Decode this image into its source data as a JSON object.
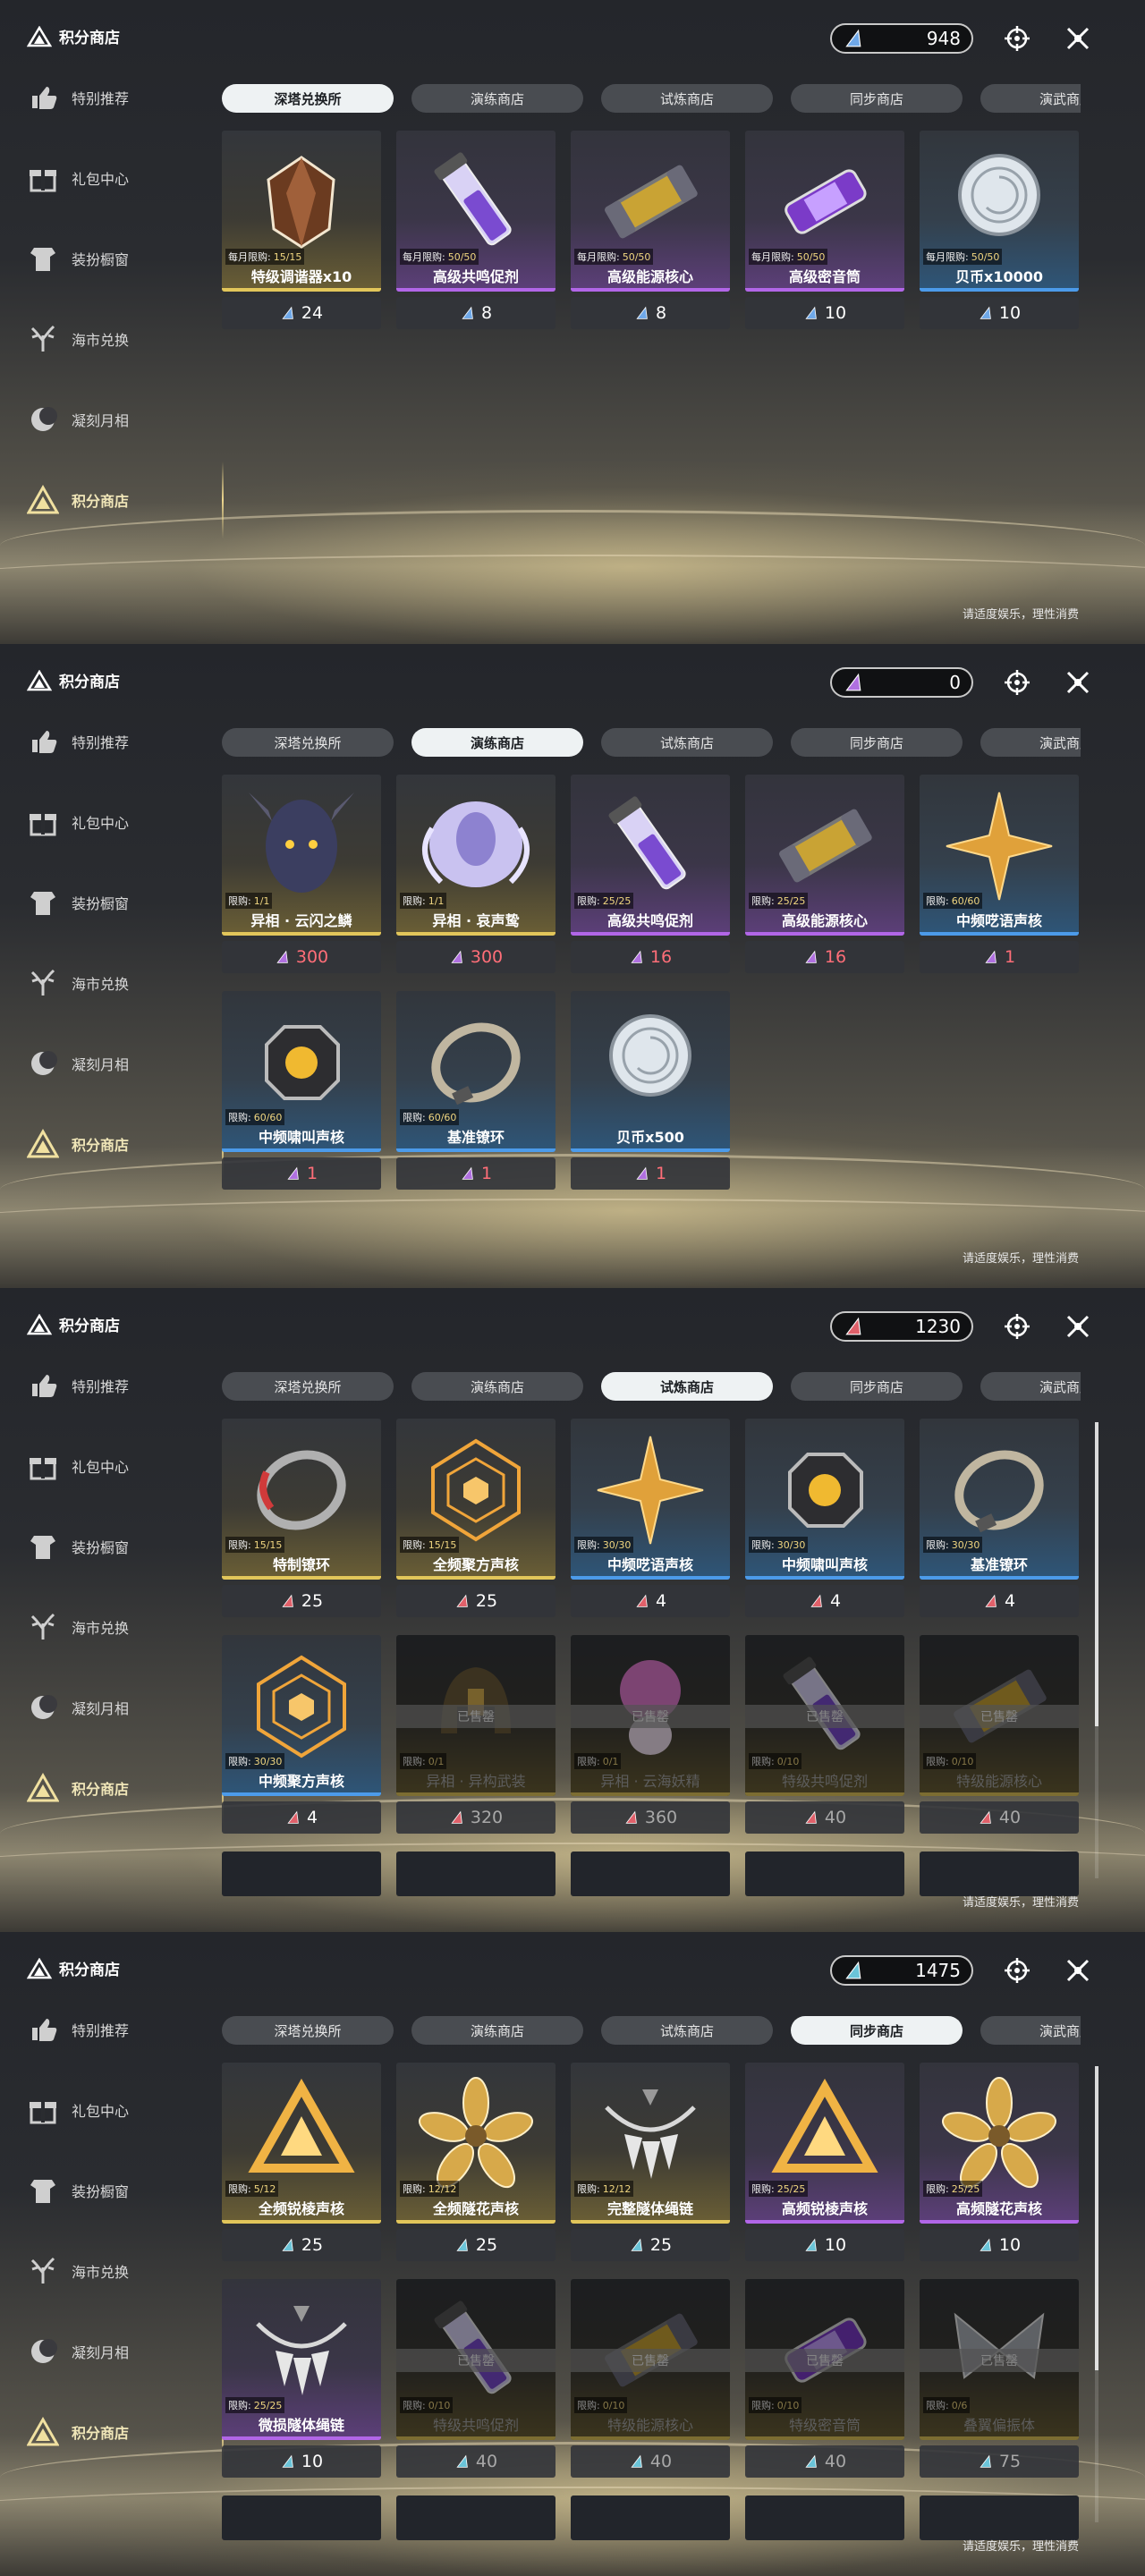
{
  "footer": "请适度娱乐，理性消费",
  "sidebar_title": "积分商店",
  "sidebar_items": [
    {
      "label": "特别推荐",
      "icon": "thumb-up-icon"
    },
    {
      "label": "礼包中心",
      "icon": "gift-icon"
    },
    {
      "label": "装扮橱窗",
      "icon": "wardrobe-icon"
    },
    {
      "label": "海市兑换",
      "icon": "coral-icon"
    },
    {
      "label": "凝刻月相",
      "icon": "moon-icon"
    },
    {
      "label": "积分商店",
      "icon": "triangle-icon"
    }
  ],
  "tabs": [
    "深塔兑换所",
    "演练商店",
    "试炼商店",
    "同步商店",
    "演武商店"
  ],
  "colors": {
    "gold": "#e2c65a",
    "purple": "#b266e8",
    "blue": "#4c9bea",
    "price_red": "#ff6e78"
  },
  "panels": [
    {
      "active_tab": 0,
      "currency": {
        "amount": "948",
        "color": "#6fa8e8"
      },
      "scroll": false,
      "items": [
        {
          "limit_label": "每月限购:",
          "limit": "15/15",
          "name": "特级调谐器x10",
          "price": "24",
          "quality": "gold",
          "art": "crystal",
          "sold": false,
          "red": false
        },
        {
          "limit_label": "每月限购:",
          "limit": "50/50",
          "name": "高级共鸣促剂",
          "price": "8",
          "quality": "purple",
          "art": "vial",
          "sold": false,
          "red": false
        },
        {
          "limit_label": "每月限购:",
          "limit": "50/50",
          "name": "高级能源核心",
          "price": "8",
          "quality": "purple",
          "art": "capsule",
          "sold": false,
          "red": false
        },
        {
          "limit_label": "每月限购:",
          "limit": "50/50",
          "name": "高级密音筒",
          "price": "10",
          "quality": "purple",
          "art": "tube",
          "sold": false,
          "red": false
        },
        {
          "limit_label": "每月限购:",
          "limit": "50/50",
          "name": "贝币x10000",
          "price": "10",
          "quality": "blue",
          "art": "coin",
          "sold": false,
          "red": false
        }
      ]
    },
    {
      "active_tab": 1,
      "currency": {
        "amount": "0",
        "color": "#b070e0"
      },
      "scroll": false,
      "items": [
        {
          "limit_label": "限购:",
          "limit": "1/1",
          "name": "异相 · 云闪之鳞",
          "price": "300",
          "quality": "gold",
          "art": "mask",
          "sold": false,
          "red": true
        },
        {
          "limit_label": "限购:",
          "limit": "1/1",
          "name": "异相 · 哀声鸷",
          "price": "300",
          "quality": "gold",
          "art": "bird",
          "sold": false,
          "red": true
        },
        {
          "limit_label": "限购:",
          "limit": "25/25",
          "name": "高级共鸣促剂",
          "price": "16",
          "quality": "purple",
          "art": "vial",
          "sold": false,
          "red": true
        },
        {
          "limit_label": "限购:",
          "limit": "25/25",
          "name": "高级能源核心",
          "price": "16",
          "quality": "purple",
          "art": "capsule",
          "sold": false,
          "red": true
        },
        {
          "limit_label": "限购:",
          "limit": "60/60",
          "name": "中频呓语声核",
          "price": "1",
          "quality": "blue",
          "art": "star",
          "sold": false,
          "red": true
        },
        {
          "limit_label": "限购:",
          "limit": "60/60",
          "name": "中频啸叫声核",
          "price": "1",
          "quality": "blue",
          "art": "orb",
          "sold": false,
          "red": true
        },
        {
          "limit_label": "限购:",
          "limit": "60/60",
          "name": "基准镣环",
          "price": "1",
          "quality": "blue",
          "art": "ring",
          "sold": false,
          "red": true
        },
        {
          "limit_label": "",
          "limit": "",
          "name": "贝币x500",
          "price": "1",
          "quality": "blue",
          "art": "coin",
          "sold": false,
          "red": true
        }
      ]
    },
    {
      "active_tab": 2,
      "currency": {
        "amount": "1230",
        "color": "#e0606a"
      },
      "scroll": true,
      "items": [
        {
          "limit_label": "限购:",
          "limit": "15/15",
          "name": "特制镣环",
          "price": "25",
          "quality": "gold",
          "art": "ring-red",
          "sold": false,
          "red": false
        },
        {
          "limit_label": "限购:",
          "limit": "15/15",
          "name": "全频聚方声核",
          "price": "25",
          "quality": "gold",
          "art": "web",
          "sold": false,
          "red": false
        },
        {
          "limit_label": "限购:",
          "limit": "30/30",
          "name": "中频呓语声核",
          "price": "4",
          "quality": "blue",
          "art": "star",
          "sold": false,
          "red": false
        },
        {
          "limit_label": "限购:",
          "limit": "30/30",
          "name": "中频啸叫声核",
          "price": "4",
          "quality": "blue",
          "art": "orb",
          "sold": false,
          "red": false
        },
        {
          "limit_label": "限购:",
          "limit": "30/30",
          "name": "基准镣环",
          "price": "4",
          "quality": "blue",
          "art": "ring",
          "sold": false,
          "red": false
        },
        {
          "limit_label": "限购:",
          "limit": "30/30",
          "name": "中频聚方声核",
          "price": "4",
          "quality": "blue",
          "art": "web",
          "sold": false,
          "red": false
        },
        {
          "limit_label": "限购:",
          "limit": "0/1",
          "name": "异相 · 异构武装",
          "price": "320",
          "quality": "gold",
          "art": "helmet",
          "sold": true,
          "red": false
        },
        {
          "limit_label": "限购:",
          "limit": "0/1",
          "name": "异相 · 云海妖精",
          "price": "360",
          "quality": "gold",
          "art": "fairy",
          "sold": true,
          "red": false
        },
        {
          "limit_label": "限购:",
          "limit": "0/10",
          "name": "特级共鸣促剂",
          "price": "40",
          "quality": "gold",
          "art": "vial",
          "sold": true,
          "red": false
        },
        {
          "limit_label": "限购:",
          "limit": "0/10",
          "name": "特级能源核心",
          "price": "40",
          "quality": "gold",
          "art": "capsule",
          "sold": true,
          "red": false
        }
      ]
    },
    {
      "active_tab": 3,
      "currency": {
        "amount": "1475",
        "color": "#6ac4d8"
      },
      "scroll": true,
      "items": [
        {
          "limit_label": "限购:",
          "limit": "5/12",
          "name": "全频锐棱声核",
          "price": "25",
          "quality": "gold",
          "art": "tri",
          "sold": false,
          "red": false
        },
        {
          "limit_label": "限购:",
          "limit": "12/12",
          "name": "全频隧花声核",
          "price": "25",
          "quality": "gold",
          "art": "flower",
          "sold": false,
          "red": false
        },
        {
          "limit_label": "限购:",
          "limit": "12/12",
          "name": "完整隧体绳链",
          "price": "25",
          "quality": "gold",
          "art": "chain",
          "sold": false,
          "red": false
        },
        {
          "limit_label": "限购:",
          "limit": "25/25",
          "name": "高频锐棱声核",
          "price": "10",
          "quality": "purple",
          "art": "tri",
          "sold": false,
          "red": false
        },
        {
          "limit_label": "限购:",
          "limit": "25/25",
          "name": "高频隧花声核",
          "price": "10",
          "quality": "purple",
          "art": "flower",
          "sold": false,
          "red": false
        },
        {
          "limit_label": "限购:",
          "limit": "25/25",
          "name": "微损隧体绳链",
          "price": "10",
          "quality": "purple",
          "art": "chain",
          "sold": false,
          "red": false
        },
        {
          "limit_label": "限购:",
          "limit": "0/10",
          "name": "特级共鸣促剂",
          "price": "40",
          "quality": "gold",
          "art": "vial",
          "sold": true,
          "red": false
        },
        {
          "limit_label": "限购:",
          "limit": "0/10",
          "name": "特级能源核心",
          "price": "40",
          "quality": "gold",
          "art": "capsule",
          "sold": true,
          "red": false
        },
        {
          "limit_label": "限购:",
          "limit": "0/10",
          "name": "特级密音筒",
          "price": "40",
          "quality": "gold",
          "art": "tube",
          "sold": true,
          "red": false
        },
        {
          "limit_label": "限购:",
          "limit": "0/6",
          "name": "叠翼偏振体",
          "price": "75",
          "quality": "gold",
          "art": "wing",
          "sold": true,
          "red": false
        }
      ]
    }
  ],
  "sold_label": "已售罄"
}
